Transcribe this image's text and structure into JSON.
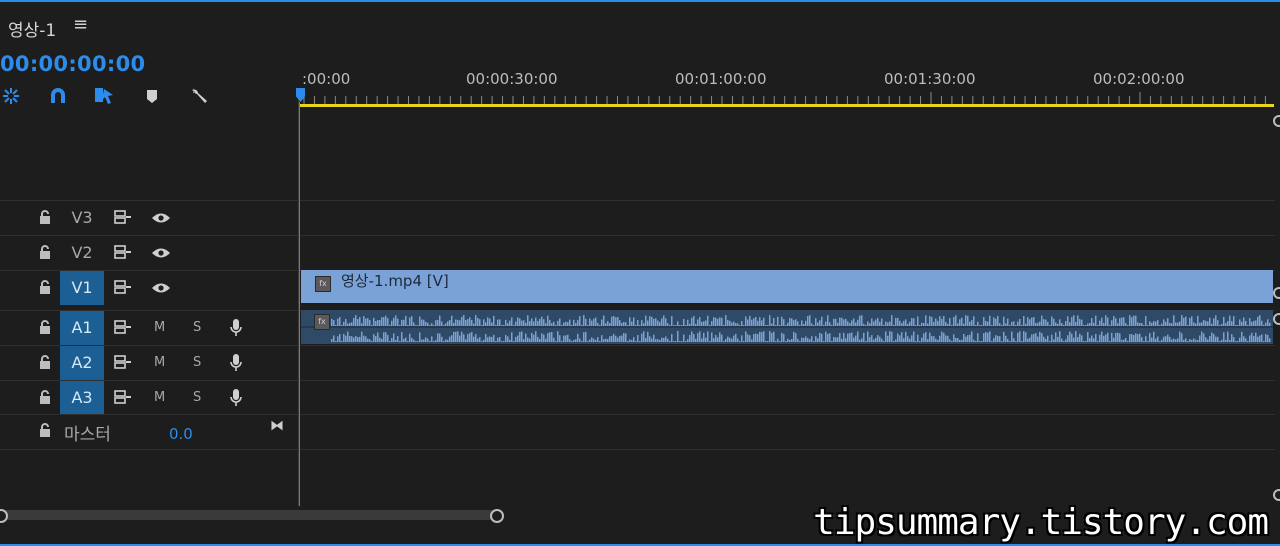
{
  "sequence": {
    "tab_label": "영상-1",
    "menu_icon": "hamburger-menu-icon",
    "timecode": "00:00:00:00"
  },
  "toolbar": {
    "tools": [
      "nest-insert-icon",
      "snap-magnet-icon",
      "linked-selection-icon",
      "add-marker-icon",
      "settings-wrench-icon"
    ]
  },
  "ruler": {
    "labels": [
      ":00:00",
      "00:00:30:00",
      "00:01:00:00",
      "00:01:30:00",
      "00:02:00:00"
    ]
  },
  "tracks": {
    "video": [
      {
        "name": "V3",
        "active": false
      },
      {
        "name": "V2",
        "active": false
      },
      {
        "name": "V1",
        "active": true
      }
    ],
    "audio": [
      {
        "name": "A1",
        "mute": "M",
        "solo": "S"
      },
      {
        "name": "A2",
        "mute": "M",
        "solo": "S"
      },
      {
        "name": "A3",
        "mute": "M",
        "solo": "S"
      }
    ],
    "master": {
      "label": "마스터",
      "value": "0.0"
    }
  },
  "clips": {
    "video_label": "영상-1.mp4 [V]"
  },
  "colors": {
    "accent": "#2d8ceb",
    "video_clip": "#7aa2d6",
    "audio_clip": "#2f4a66",
    "work_area": "#e8d51c",
    "active_track": "#1c5f94"
  },
  "watermark": "tipsummary.tistory.com"
}
